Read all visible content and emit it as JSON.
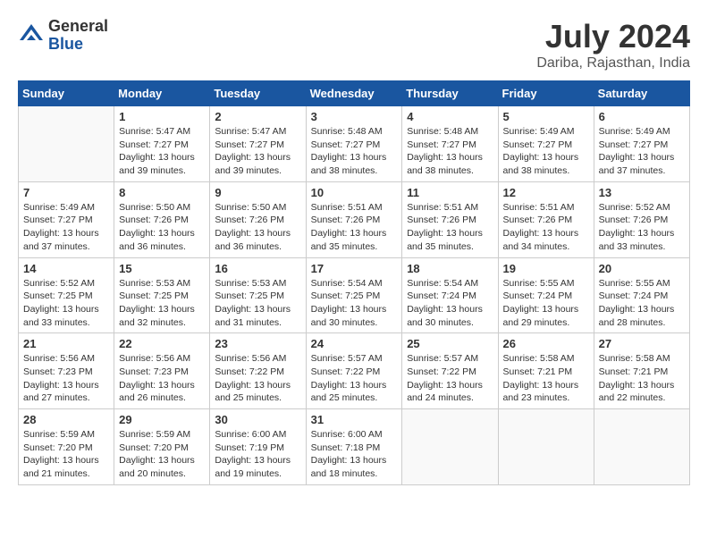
{
  "logo": {
    "general": "General",
    "blue": "Blue"
  },
  "title": {
    "month_year": "July 2024",
    "location": "Dariba, Rajasthan, India"
  },
  "headers": [
    "Sunday",
    "Monday",
    "Tuesday",
    "Wednesday",
    "Thursday",
    "Friday",
    "Saturday"
  ],
  "weeks": [
    [
      {
        "day": "",
        "info": ""
      },
      {
        "day": "1",
        "info": "Sunrise: 5:47 AM\nSunset: 7:27 PM\nDaylight: 13 hours\nand 39 minutes."
      },
      {
        "day": "2",
        "info": "Sunrise: 5:47 AM\nSunset: 7:27 PM\nDaylight: 13 hours\nand 39 minutes."
      },
      {
        "day": "3",
        "info": "Sunrise: 5:48 AM\nSunset: 7:27 PM\nDaylight: 13 hours\nand 38 minutes."
      },
      {
        "day": "4",
        "info": "Sunrise: 5:48 AM\nSunset: 7:27 PM\nDaylight: 13 hours\nand 38 minutes."
      },
      {
        "day": "5",
        "info": "Sunrise: 5:49 AM\nSunset: 7:27 PM\nDaylight: 13 hours\nand 38 minutes."
      },
      {
        "day": "6",
        "info": "Sunrise: 5:49 AM\nSunset: 7:27 PM\nDaylight: 13 hours\nand 37 minutes."
      }
    ],
    [
      {
        "day": "7",
        "info": "Sunrise: 5:49 AM\nSunset: 7:27 PM\nDaylight: 13 hours\nand 37 minutes."
      },
      {
        "day": "8",
        "info": "Sunrise: 5:50 AM\nSunset: 7:26 PM\nDaylight: 13 hours\nand 36 minutes."
      },
      {
        "day": "9",
        "info": "Sunrise: 5:50 AM\nSunset: 7:26 PM\nDaylight: 13 hours\nand 36 minutes."
      },
      {
        "day": "10",
        "info": "Sunrise: 5:51 AM\nSunset: 7:26 PM\nDaylight: 13 hours\nand 35 minutes."
      },
      {
        "day": "11",
        "info": "Sunrise: 5:51 AM\nSunset: 7:26 PM\nDaylight: 13 hours\nand 35 minutes."
      },
      {
        "day": "12",
        "info": "Sunrise: 5:51 AM\nSunset: 7:26 PM\nDaylight: 13 hours\nand 34 minutes."
      },
      {
        "day": "13",
        "info": "Sunrise: 5:52 AM\nSunset: 7:26 PM\nDaylight: 13 hours\nand 33 minutes."
      }
    ],
    [
      {
        "day": "14",
        "info": "Sunrise: 5:52 AM\nSunset: 7:25 PM\nDaylight: 13 hours\nand 33 minutes."
      },
      {
        "day": "15",
        "info": "Sunrise: 5:53 AM\nSunset: 7:25 PM\nDaylight: 13 hours\nand 32 minutes."
      },
      {
        "day": "16",
        "info": "Sunrise: 5:53 AM\nSunset: 7:25 PM\nDaylight: 13 hours\nand 31 minutes."
      },
      {
        "day": "17",
        "info": "Sunrise: 5:54 AM\nSunset: 7:25 PM\nDaylight: 13 hours\nand 30 minutes."
      },
      {
        "day": "18",
        "info": "Sunrise: 5:54 AM\nSunset: 7:24 PM\nDaylight: 13 hours\nand 30 minutes."
      },
      {
        "day": "19",
        "info": "Sunrise: 5:55 AM\nSunset: 7:24 PM\nDaylight: 13 hours\nand 29 minutes."
      },
      {
        "day": "20",
        "info": "Sunrise: 5:55 AM\nSunset: 7:24 PM\nDaylight: 13 hours\nand 28 minutes."
      }
    ],
    [
      {
        "day": "21",
        "info": "Sunrise: 5:56 AM\nSunset: 7:23 PM\nDaylight: 13 hours\nand 27 minutes."
      },
      {
        "day": "22",
        "info": "Sunrise: 5:56 AM\nSunset: 7:23 PM\nDaylight: 13 hours\nand 26 minutes."
      },
      {
        "day": "23",
        "info": "Sunrise: 5:56 AM\nSunset: 7:22 PM\nDaylight: 13 hours\nand 25 minutes."
      },
      {
        "day": "24",
        "info": "Sunrise: 5:57 AM\nSunset: 7:22 PM\nDaylight: 13 hours\nand 25 minutes."
      },
      {
        "day": "25",
        "info": "Sunrise: 5:57 AM\nSunset: 7:22 PM\nDaylight: 13 hours\nand 24 minutes."
      },
      {
        "day": "26",
        "info": "Sunrise: 5:58 AM\nSunset: 7:21 PM\nDaylight: 13 hours\nand 23 minutes."
      },
      {
        "day": "27",
        "info": "Sunrise: 5:58 AM\nSunset: 7:21 PM\nDaylight: 13 hours\nand 22 minutes."
      }
    ],
    [
      {
        "day": "28",
        "info": "Sunrise: 5:59 AM\nSunset: 7:20 PM\nDaylight: 13 hours\nand 21 minutes."
      },
      {
        "day": "29",
        "info": "Sunrise: 5:59 AM\nSunset: 7:20 PM\nDaylight: 13 hours\nand 20 minutes."
      },
      {
        "day": "30",
        "info": "Sunrise: 6:00 AM\nSunset: 7:19 PM\nDaylight: 13 hours\nand 19 minutes."
      },
      {
        "day": "31",
        "info": "Sunrise: 6:00 AM\nSunset: 7:18 PM\nDaylight: 13 hours\nand 18 minutes."
      },
      {
        "day": "",
        "info": ""
      },
      {
        "day": "",
        "info": ""
      },
      {
        "day": "",
        "info": ""
      }
    ]
  ]
}
